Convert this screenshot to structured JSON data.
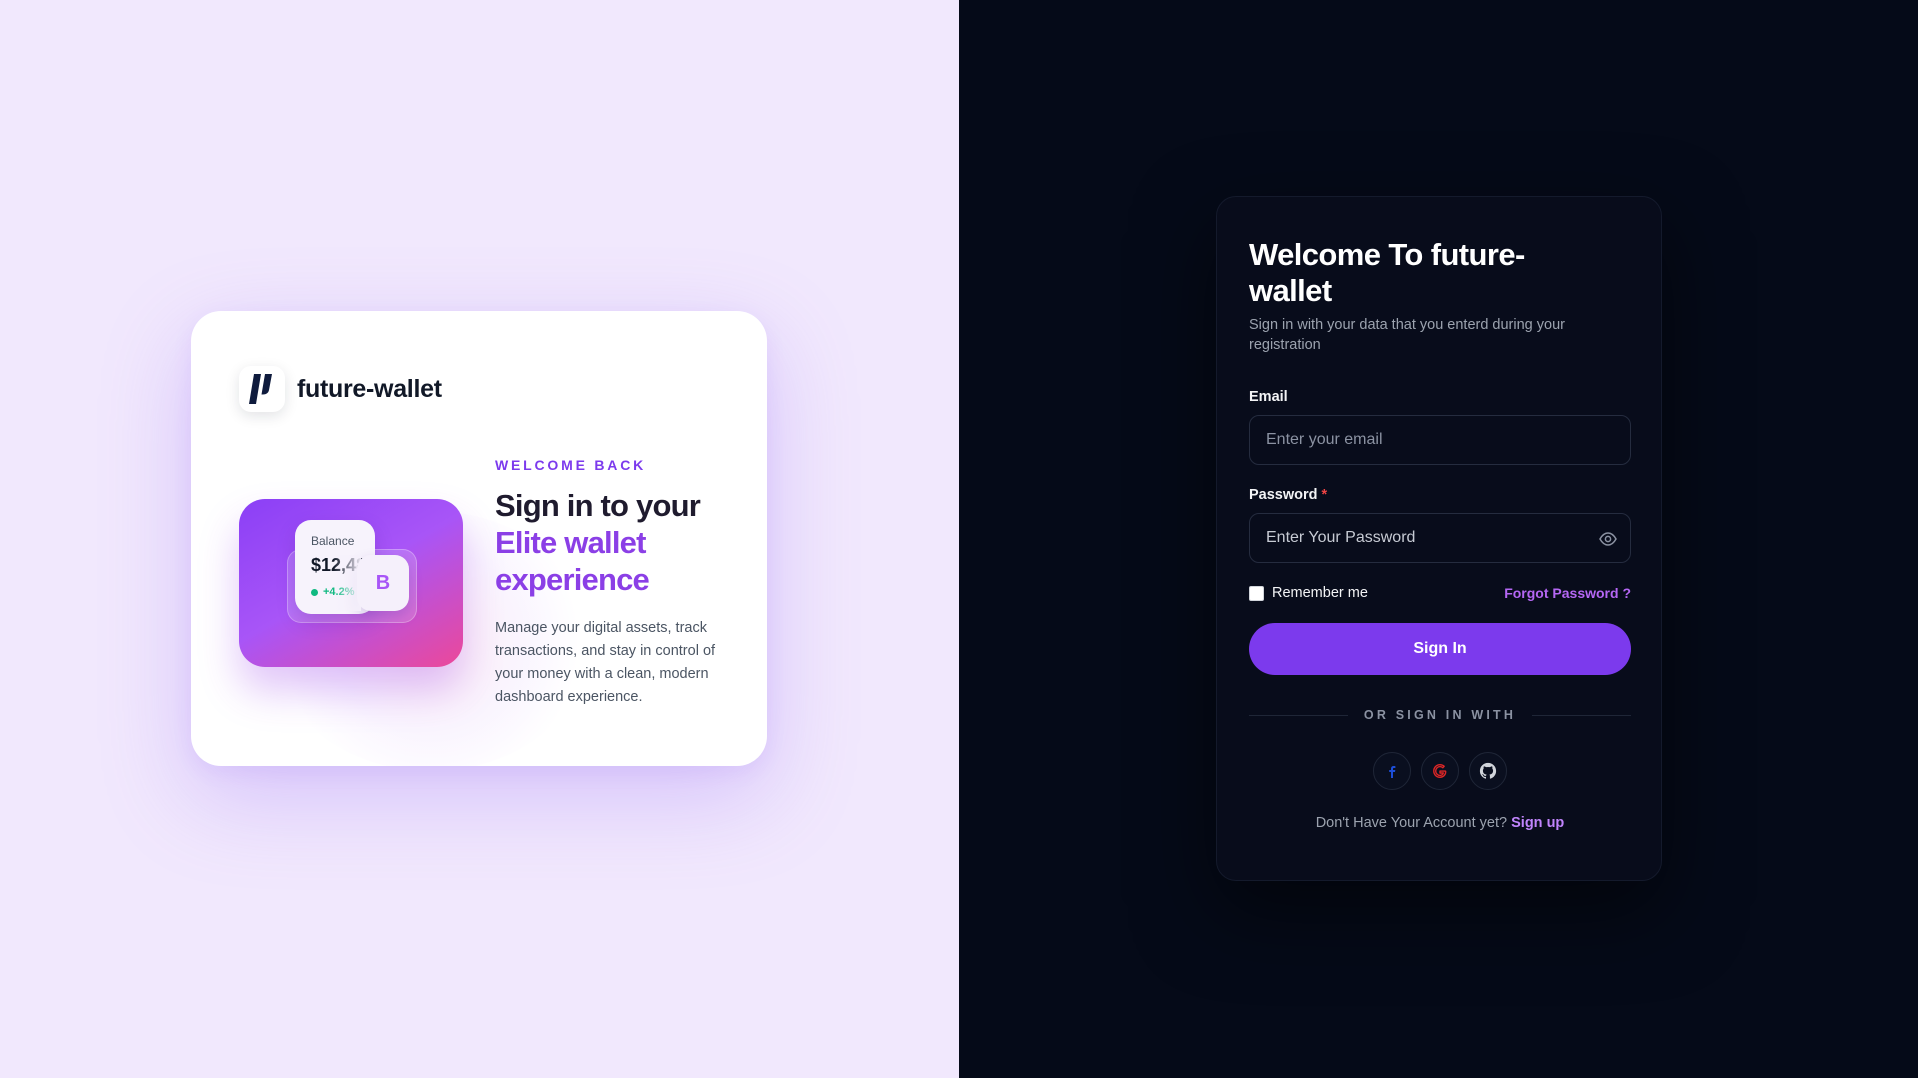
{
  "brand": {
    "name": "future-wallet",
    "kicker": "WELCOME BACK",
    "title_line1": "Sign in to your",
    "title_accent": "Elite wallet experience",
    "description": "Manage your digital assets, track transactions, and stay in control of your money with a clean, modern dashboard experience.",
    "balance_label": "Balance",
    "balance_value": "$12,480",
    "balance_change": "+4.2%",
    "coin_symbol": "B"
  },
  "login": {
    "title": "Welcome To future-wallet",
    "subtitle": "Sign in with your data that you enterd during your registration",
    "email_label": "Email",
    "email_placeholder": "Enter your email",
    "email_value": "",
    "password_label": "Password",
    "password_required_mark": "*",
    "password_placeholder": "Enter Your Password",
    "password_value": "",
    "remember_label": "Remember me",
    "remember_checked": false,
    "forgot_label": "Forgot Password ?",
    "signin_label": "Sign In",
    "divider_text": "OR SIGN IN WITH",
    "social": [
      {
        "icon": "facebook-icon",
        "color": "#1d4ed8"
      },
      {
        "icon": "google-icon",
        "color": "#dc2626"
      },
      {
        "icon": "github-icon",
        "color": "#d1d5db"
      }
    ],
    "signup_prompt": "Don't Have Your Account yet?",
    "signup_link": "Sign up"
  },
  "colors": {
    "left_bg": "#f1e8fd",
    "right_bg": "#050a18",
    "accent": "#7c3aed",
    "accent_text": "#8b3fe6",
    "link": "#c084fc"
  }
}
